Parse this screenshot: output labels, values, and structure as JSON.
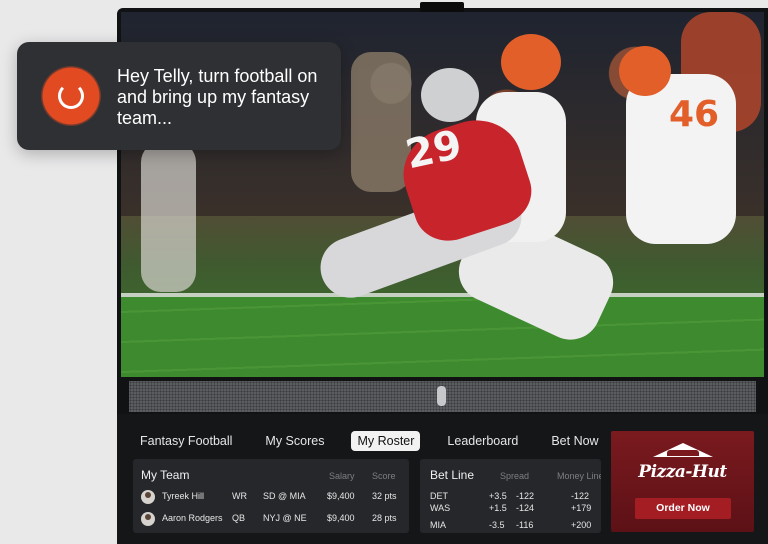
{
  "voice_prompt": {
    "text": "Hey Telly, turn football on and bring up my fantasy team...",
    "mic_icon": "loading-ring-icon"
  },
  "scene": {
    "jersey_numbers": [
      "29",
      "46"
    ]
  },
  "nav": {
    "tabs": [
      {
        "label": "Fantasy Football",
        "active": false
      },
      {
        "label": "My Scores",
        "active": false
      },
      {
        "label": "My Roster",
        "active": true
      },
      {
        "label": "Leaderboard",
        "active": false
      },
      {
        "label": "Bet Now",
        "active": false
      }
    ]
  },
  "my_team": {
    "title": "My Team",
    "columns": {
      "salary": "Salary",
      "score": "Score"
    },
    "players": [
      {
        "name": "Tyreek Hill",
        "pos": "WR",
        "matchup": "SD @ MIA",
        "salary": "$9,400",
        "score": "32 pts"
      },
      {
        "name": "Aaron Rodgers",
        "pos": "QB",
        "matchup": "NYJ @ NE",
        "salary": "$9,400",
        "score": "28 pts"
      }
    ]
  },
  "bet_line": {
    "title": "Bet Line",
    "columns": {
      "spread": "Spread",
      "moneyline": "Money Line"
    },
    "rows": [
      {
        "team": "DET",
        "spread": "+3.5",
        "odds": "-122",
        "moneyline": "-122"
      },
      {
        "team": "WAS",
        "spread": "+1.5",
        "odds": "-124",
        "moneyline": "+179"
      },
      {
        "team": "MIA",
        "spread": "-3.5",
        "odds": "-116",
        "moneyline": "+200"
      }
    ]
  },
  "ad": {
    "brand": "Pizza-Hut",
    "cta": "Order Now",
    "colors": {
      "background": "#6a1419",
      "button": "#a31d23"
    }
  },
  "colors": {
    "accent": "#e24a22",
    "panel": "#151618",
    "card": "#26272a"
  }
}
